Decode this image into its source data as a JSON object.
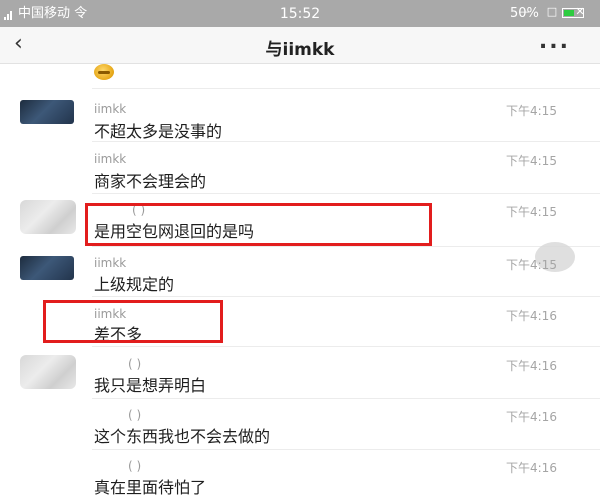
{
  "status_bar": {
    "carrier": "中国移动 令",
    "time": "15:52",
    "battery": "50%",
    "window_controls": [
      "—",
      "□",
      "✕"
    ]
  },
  "header": {
    "back_icon": "‹",
    "title": "与iimkk",
    "more_icon": "..."
  },
  "messages": [
    {
      "avatar": "dark",
      "sender": "iimkk",
      "time": "下午4:15",
      "text": "不超太多是没事的"
    },
    {
      "avatar": "none",
      "sender": "iimkk",
      "time": "下午4:15",
      "text": "商家不会理会的"
    },
    {
      "avatar": "blur",
      "sender": "(    )",
      "time": "下午4:15",
      "text": "是用空包网退回的是吗",
      "highlighted": true
    },
    {
      "avatar": "dark",
      "sender": "iimkk",
      "time": "下午4:15",
      "text": "上级规定的"
    },
    {
      "avatar": "none",
      "sender": "iimkk",
      "time": "下午4:16",
      "text": "差不多",
      "highlighted": true
    },
    {
      "avatar": "blur",
      "sender": "(    )",
      "time": "下午4:16",
      "text": "我只是想弄明白"
    },
    {
      "avatar": "none",
      "sender": "(    )",
      "time": "下午4:16",
      "text": "这个东西我也不会去做的"
    },
    {
      "avatar": "none",
      "sender": "(    )",
      "time": "下午4:16",
      "text": "真在里面待怕了"
    }
  ],
  "colors": {
    "status_bar_bg": "#a9a9a9",
    "highlight_border": "#e21d1d",
    "time_text": "#a5a5a5"
  }
}
